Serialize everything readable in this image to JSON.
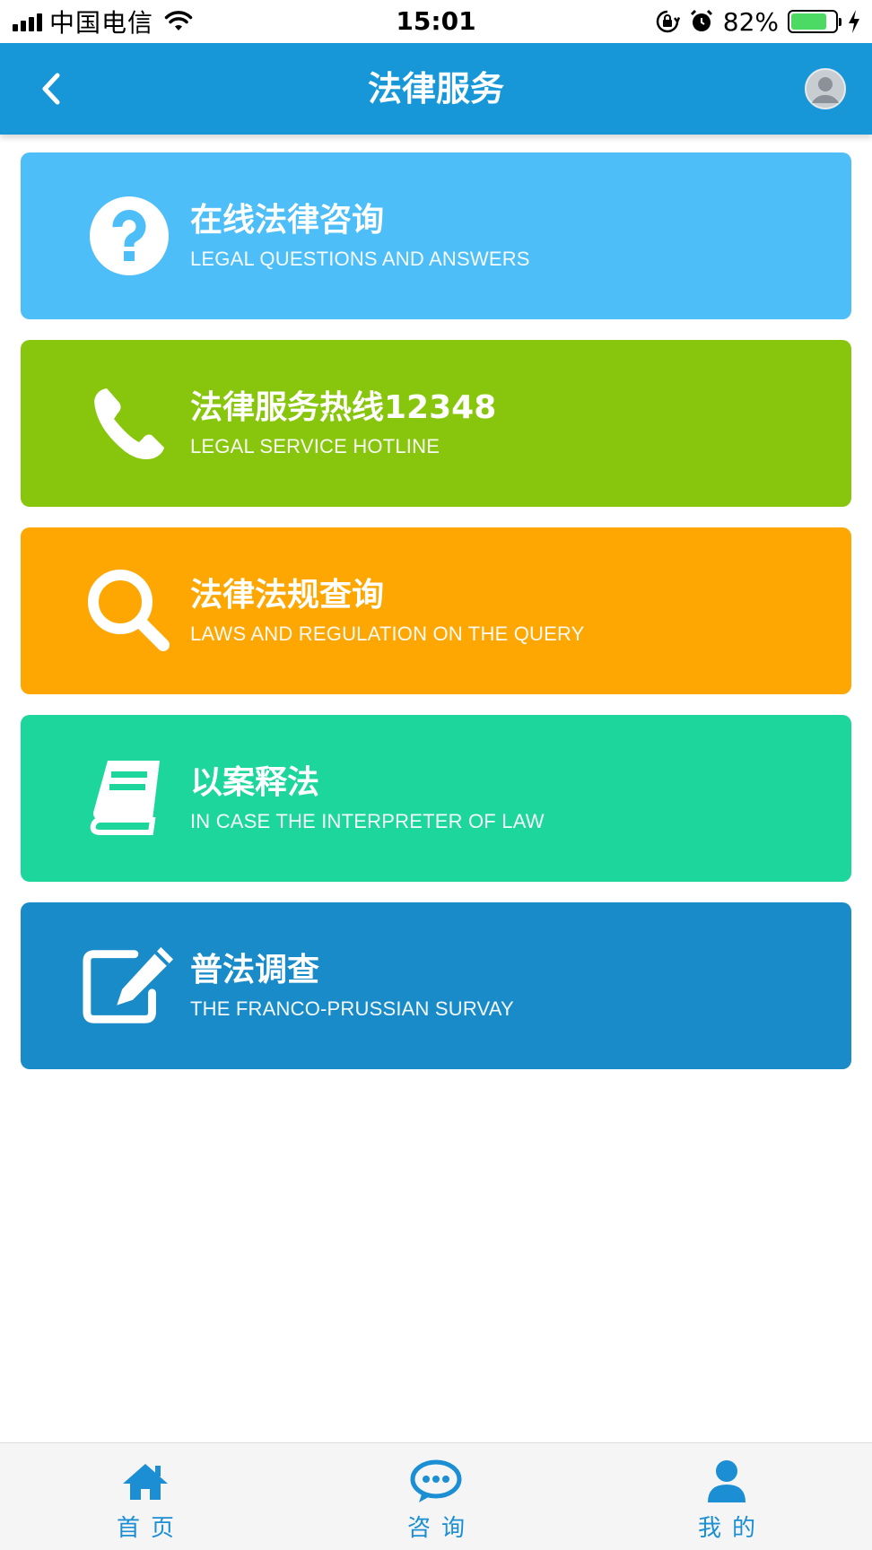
{
  "status_bar": {
    "carrier": "中国电信",
    "time": "15:01",
    "battery_percent": "82%",
    "battery_level": 0.82
  },
  "nav": {
    "title": "法律服务",
    "back_icon": "chevron-left-icon",
    "avatar_icon": "user-avatar-icon"
  },
  "cards": [
    {
      "title": "在线法律咨询",
      "subtitle": "LEGAL QUESTIONS AND ANSWERS",
      "icon": "question-circle-icon",
      "color": "#4dbef8"
    },
    {
      "title": "法律服务热线12348",
      "subtitle": "LEGAL SERVICE HOTLINE",
      "icon": "phone-icon",
      "color": "#88c60d"
    },
    {
      "title": "法律法规查询",
      "subtitle": "LAWS AND REGULATION ON THE QUERY",
      "icon": "search-icon",
      "color": "#fea703"
    },
    {
      "title": "以案释法",
      "subtitle": "IN CASE THE INTERPRETER OF LAW",
      "icon": "book-icon",
      "color": "#1dd69b"
    },
    {
      "title": "普法调查",
      "subtitle": "THE FRANCO-PRUSSIAN SURVAY",
      "icon": "edit-icon",
      "color": "#1a8bc9"
    }
  ],
  "tabs": [
    {
      "label": "首页",
      "icon": "home-icon"
    },
    {
      "label": "咨询",
      "icon": "chat-bubble-icon"
    },
    {
      "label": "我的",
      "icon": "user-icon"
    }
  ],
  "colors": {
    "nav_bg": "#1797d8",
    "tab_accent": "#1b8ed4"
  }
}
